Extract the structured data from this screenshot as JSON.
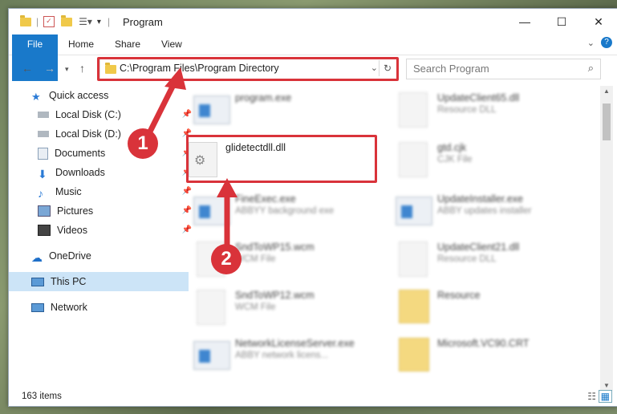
{
  "window": {
    "title": "Program"
  },
  "ribbon": {
    "tabs": [
      "File",
      "Home",
      "Share",
      "View"
    ]
  },
  "address": {
    "path": "C:\\Program Files\\Program Directory"
  },
  "search": {
    "placeholder": "Search Program"
  },
  "sidebar": {
    "items": [
      {
        "label": "Quick access",
        "icon": "star-icon",
        "pinned": false
      },
      {
        "label": "Local Disk (C:)",
        "icon": "drive-icon",
        "pinned": true
      },
      {
        "label": "Local Disk (D:)",
        "icon": "drive-icon",
        "pinned": true
      },
      {
        "label": "Documents",
        "icon": "documents-icon",
        "pinned": true
      },
      {
        "label": "Downloads",
        "icon": "download-icon",
        "pinned": true
      },
      {
        "label": "Music",
        "icon": "music-icon",
        "pinned": true
      },
      {
        "label": "Pictures",
        "icon": "pictures-icon",
        "pinned": true
      },
      {
        "label": "Videos",
        "icon": "videos-icon",
        "pinned": true
      },
      {
        "label": "OneDrive",
        "icon": "cloud-icon",
        "pinned": false
      },
      {
        "label": "This PC",
        "icon": "computer-icon",
        "pinned": false,
        "selected": true
      },
      {
        "label": "Network",
        "icon": "network-icon",
        "pinned": false
      }
    ]
  },
  "files": [
    {
      "name": "program.exe",
      "type": ""
    },
    {
      "name": "UpdateClient65.dll",
      "type": "Resource DLL"
    },
    {
      "name": "glidetectdll.dll",
      "type": ""
    },
    {
      "name": "gtd.cjk",
      "type": "CJK File"
    },
    {
      "name": "FineExec.exe",
      "type": "ABBYY background exe"
    },
    {
      "name": "UpdateInstaller.exe",
      "type": "ABBY updates installer"
    },
    {
      "name": "SndToWP15.wcm",
      "type": "WCM File"
    },
    {
      "name": "UpdateClient21.dll",
      "type": "Resource DLL"
    },
    {
      "name": "SndToWP12.wcm",
      "type": "WCM File"
    },
    {
      "name": "Resource",
      "type": ""
    },
    {
      "name": "NetworkLicenseServer.exe",
      "type": "ABBY network licens..."
    },
    {
      "name": "Microsoft.VC90.CRT",
      "type": ""
    }
  ],
  "status": {
    "count": "163 items"
  },
  "annotations": {
    "step1": "1",
    "step2": "2"
  },
  "colors": {
    "accent": "#1979ca",
    "highlight": "#d9333a",
    "selected": "#cce4f7"
  }
}
